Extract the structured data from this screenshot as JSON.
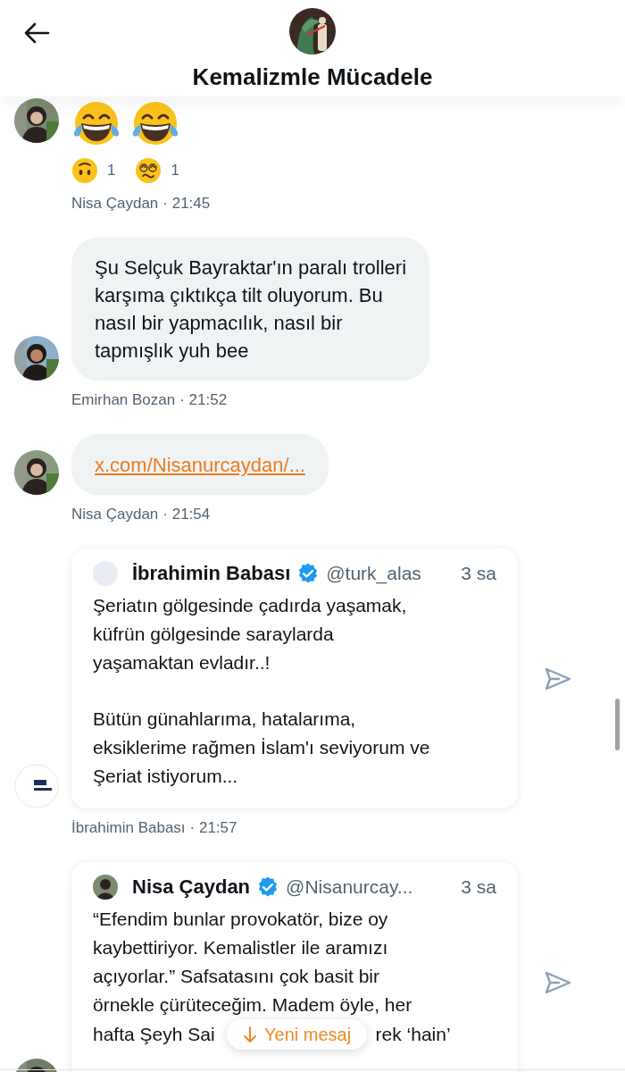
{
  "header": {
    "title": "Kemalizmle Mücadele"
  },
  "messages": [
    {
      "kind": "emoji",
      "emojis": [
        {
          "kind": "laughing"
        },
        {
          "kind": "laughing"
        }
      ],
      "reactions": [
        {
          "kind": "upside-down",
          "count": "1"
        },
        {
          "kind": "dizzy",
          "count": "1"
        }
      ],
      "sender": "Nisa Çaydan",
      "time": "· 21:45"
    },
    {
      "kind": "text",
      "lines": [
        "Şu Selçuk Bayraktar'ın paralı trolleri",
        "karşıma çıktıkça tilt oluyorum. Bu",
        "nasıl bir yapmacılık, nasıl bir",
        "tapmışlık yuh bee"
      ],
      "sender": "Emirhan Bozan",
      "time": "· 21:52"
    },
    {
      "kind": "link",
      "link": "x.com/Nisanurcaydan/...",
      "sender": "Nisa Çaydan",
      "time": "· 21:54"
    },
    {
      "kind": "quote",
      "author": "İbrahimin Babası",
      "verified": true,
      "handle": "@turk_alas",
      "age": "3 sa",
      "paragraphs": [
        [
          "Şeriatın gölgesinde çadırda yaşamak,",
          "küfrün gölgesinde saraylarda",
          "yaşamaktan evladır..!"
        ],
        [
          "Bütün günahlarıma, hatalarıma,",
          "eksiklerime rağmen İslam'ı seviyorum ve",
          "Şeriat istiyorum..."
        ]
      ],
      "sender": "İbrahimin Babası",
      "time": "· 21:57"
    },
    {
      "kind": "quote",
      "author": "Nisa Çaydan",
      "verified": true,
      "handle": "@Nisanurcay...",
      "age": "3 sa",
      "paragraphs": [
        [
          "“Efendim bunlar provokatör, bize oy",
          "kaybettiriyor. Kemalistler ile aramızı",
          "açıyorlar.” Safsatasını çok basit bir",
          "örnekle çürüteceğim. Madem öyle, her"
        ]
      ],
      "covered_line": [
        "hafta Şeyh Sai",
        "rek ‘hain’"
      ]
    }
  ],
  "new_message_button": {
    "label": "Yeni mesaj"
  }
}
